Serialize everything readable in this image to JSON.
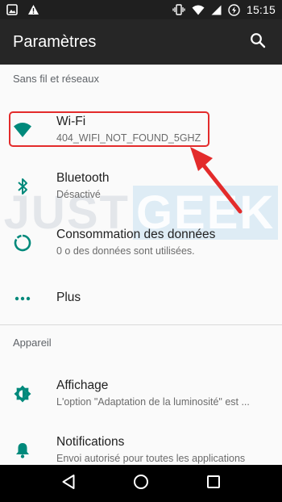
{
  "status_bar": {
    "time": "15:15",
    "left_icons": [
      "gallery-icon",
      "warning-icon"
    ],
    "right_icons": [
      "vibrate-icon",
      "wifi-signal-icon",
      "cell-signal-icon",
      "battery-charging-icon"
    ]
  },
  "app_bar": {
    "title": "Paramètres",
    "search_icon": "search-icon"
  },
  "sections": {
    "wireless": {
      "header": "Sans fil et réseaux",
      "items": [
        {
          "icon": "wifi-icon",
          "title": "Wi-Fi",
          "subtitle": "404_WIFI_NOT_FOUND_5GHZ"
        },
        {
          "icon": "bluetooth-icon",
          "title": "Bluetooth",
          "subtitle": "Désactivé"
        },
        {
          "icon": "data-usage-icon",
          "title": "Consommation des données",
          "subtitle": "0 o des données sont utilisées."
        },
        {
          "icon": "more-icon",
          "title": "Plus",
          "subtitle": ""
        }
      ]
    },
    "device": {
      "header": "Appareil",
      "items": [
        {
          "icon": "brightness-icon",
          "title": "Affichage",
          "subtitle": "L'option \"Adaptation de la luminosité\" est ..."
        },
        {
          "icon": "bell-icon",
          "title": "Notifications",
          "subtitle": "Envoi autorisé pour toutes les applications"
        }
      ]
    }
  },
  "watermark": {
    "part1": "JUST",
    "part2": "GEEK"
  },
  "nav_bar": {
    "icons": [
      "back-icon",
      "home-icon",
      "recents-icon"
    ]
  },
  "colors": {
    "accent": "#00897b",
    "highlight": "#e32b2b",
    "app_bar": "#262626",
    "status_bar": "#1f1f1f"
  }
}
